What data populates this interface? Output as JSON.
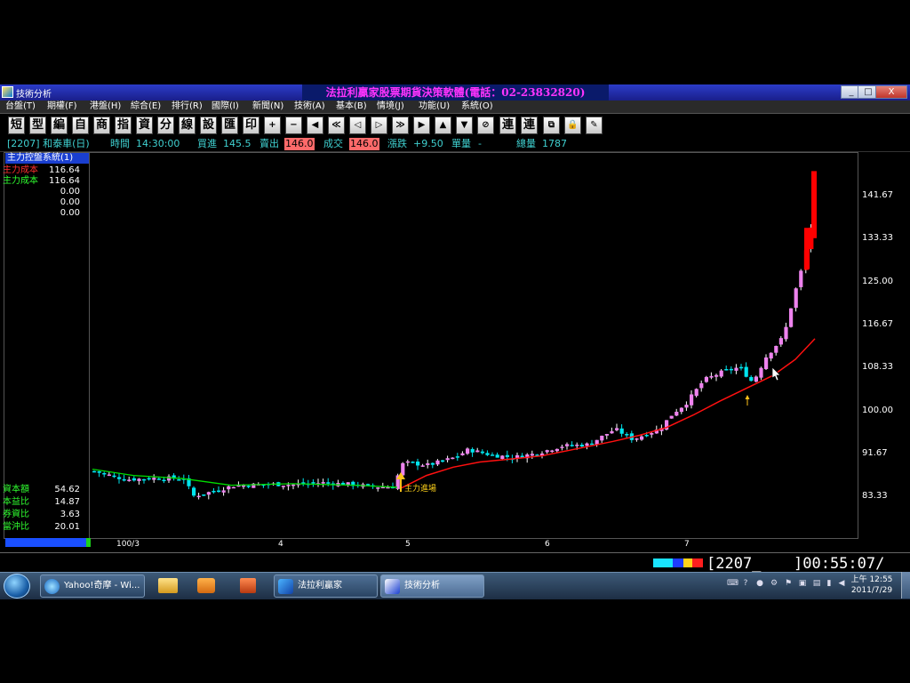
{
  "window": {
    "title": "技術分析",
    "center_title": "法拉利贏家股票期貨決策軟體(電話：02-23832820)",
    "min": "_",
    "max": "□",
    "close": "X"
  },
  "menu": [
    "台盤(T)",
    "期權(F)",
    "港盤(H)",
    "綜合(E)",
    "排行(R)",
    "國際(I)",
    "新聞(N)",
    "技術(A)",
    "基本(B)",
    "情境(J)",
    "功能(U)",
    "系統(O)"
  ],
  "toolbar": [
    "短",
    "型",
    "編",
    "自",
    "商",
    "指",
    "資",
    "分",
    "線",
    "設",
    "匯",
    "印",
    "+",
    "−",
    "◀",
    "≪",
    "◁",
    "▷",
    "≫",
    "▶",
    "▲",
    "▼",
    "⊘",
    "連",
    "連",
    "⧉",
    "🔒",
    "✎"
  ],
  "info": {
    "stock": "[2207] 和泰車(日)",
    "time_label": "時間",
    "time_value": "14:30:00",
    "bid_label": "買進",
    "bid_value": "145.5",
    "ask_label": "賣出",
    "ask_value": "146.0",
    "deal_label": "成交",
    "deal_value": "146.0",
    "change_label": "漲跌",
    "change_value": "+9.50",
    "unit_label": "單量",
    "unit_value": "-",
    "total_label": "總量",
    "total_value": "1787"
  },
  "left_panel": {
    "indicator_title": "主力控盤系統(1)",
    "rows": [
      {
        "label": "主力成本",
        "value": "116.64",
        "color": "#ff3030"
      },
      {
        "label": "主力成本",
        "value": "116.64",
        "color": "#30ff30"
      },
      {
        "label": "",
        "value": "0.00",
        "color": "#ffffff"
      },
      {
        "label": "",
        "value": "0.00",
        "color": "#ffffff"
      },
      {
        "label": "",
        "value": "0.00",
        "color": "#ffffff"
      }
    ],
    "stats": [
      {
        "label": "資本額",
        "value": "54.62"
      },
      {
        "label": "本益比",
        "value": "14.87"
      },
      {
        "label": "券資比",
        "value": "3.63"
      },
      {
        "label": "當沖比",
        "value": "20.01"
      }
    ]
  },
  "chart_data": {
    "type": "candlestick",
    "y_ticks": [
      "141.67",
      "133.33",
      "125.00",
      "116.67",
      "108.33",
      "100.00",
      "91.67",
      "83.33"
    ],
    "ylim": [
      80,
      149
    ],
    "x_ticks": [
      "100/3",
      "4",
      "5",
      "6",
      "7"
    ],
    "annotation": "主力進場",
    "up_color": "#ee82ee",
    "down_color": "#00e5ee",
    "limit_up_color": "#ff0000",
    "cost_line_color": "#ff1010",
    "pre_line_color": "#00dd00"
  },
  "status": {
    "code": "[2207_",
    "time": "]00:55:07/"
  },
  "taskbar": {
    "tasks": [
      {
        "label": "Yahoo!奇摩 - Wi..."
      },
      {
        "label": "法拉利贏家"
      },
      {
        "label": "技術分析"
      }
    ],
    "clock_time": "上午 12:55",
    "clock_date": "2011/7/29"
  }
}
